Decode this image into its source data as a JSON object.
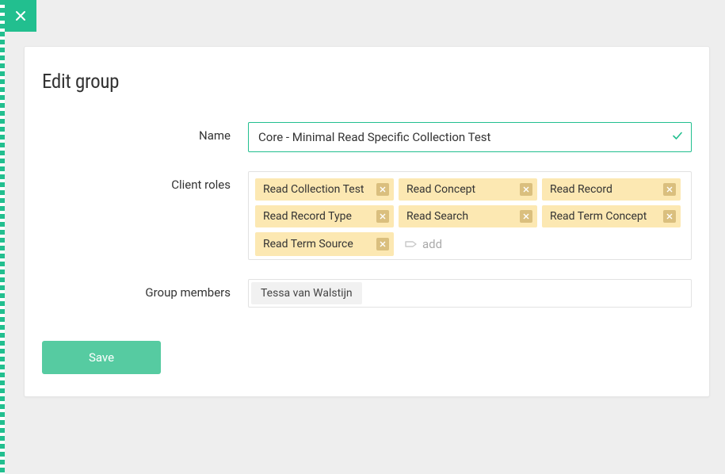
{
  "close_label": "Close",
  "card": {
    "title": "Edit group",
    "name_label": "Name",
    "name_value": "Core - Minimal Read Specific Collection Test",
    "roles_label": "Client roles",
    "roles": [
      "Read Collection Test",
      "Read Concept",
      "Read Record",
      "Read Record Type",
      "Read Search",
      "Read Term Concept",
      "Read Term Source"
    ],
    "add_placeholder": "add",
    "members_label": "Group members",
    "members": [
      "Tessa van Walstijn"
    ],
    "save_label": "Save"
  },
  "colors": {
    "accent": "#22bf8f",
    "chip_bg": "#fce8b2",
    "chip_x_bg": "#dabf7e"
  }
}
